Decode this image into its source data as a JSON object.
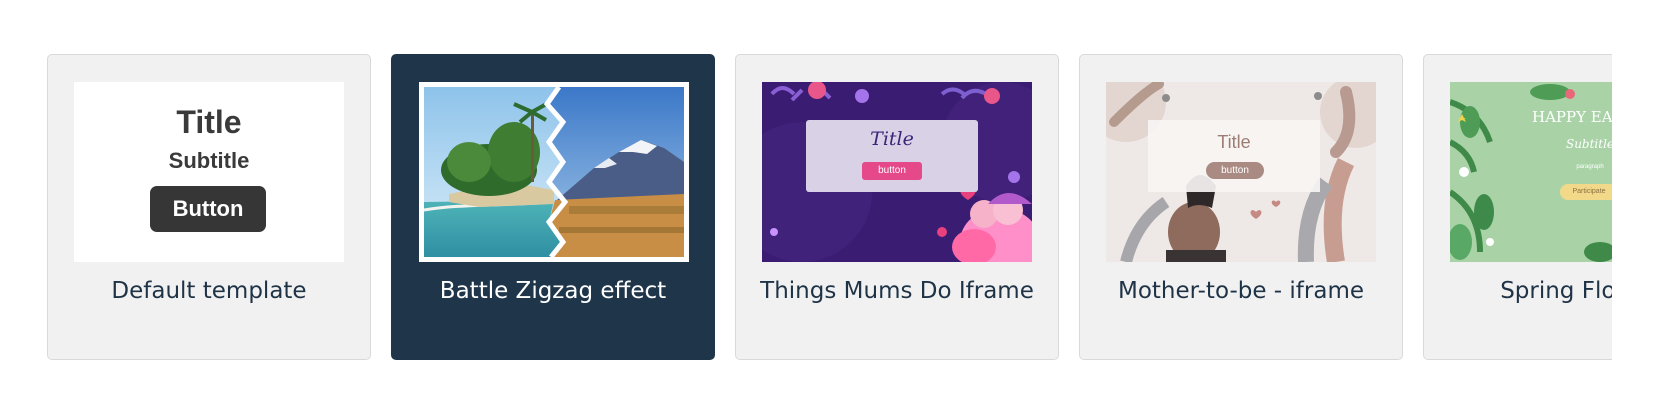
{
  "templates": [
    {
      "label": "Default template",
      "selected": false,
      "preview": {
        "title": "Title",
        "subtitle": "Subtitle",
        "button": "Button"
      }
    },
    {
      "label": "Battle Zigzag effect",
      "selected": true
    },
    {
      "label": "Things Mums Do Iframe",
      "selected": false,
      "preview": {
        "title": "Title",
        "button": "button"
      }
    },
    {
      "label": "Mother-to-be - iframe",
      "selected": false,
      "preview": {
        "title": "Title",
        "button": "button"
      }
    },
    {
      "label": "Spring Flowers",
      "selected": false,
      "preview": {
        "title": "HAPPY EAST",
        "subtitle": "Subtitle",
        "paragraph": "paragraph",
        "button": "Participate"
      }
    }
  ],
  "colors": {
    "card_background": "#f1f1f1",
    "card_selected_background": "#1f364a",
    "label_color": "#1f3347",
    "label_selected_color": "#ffffff"
  }
}
